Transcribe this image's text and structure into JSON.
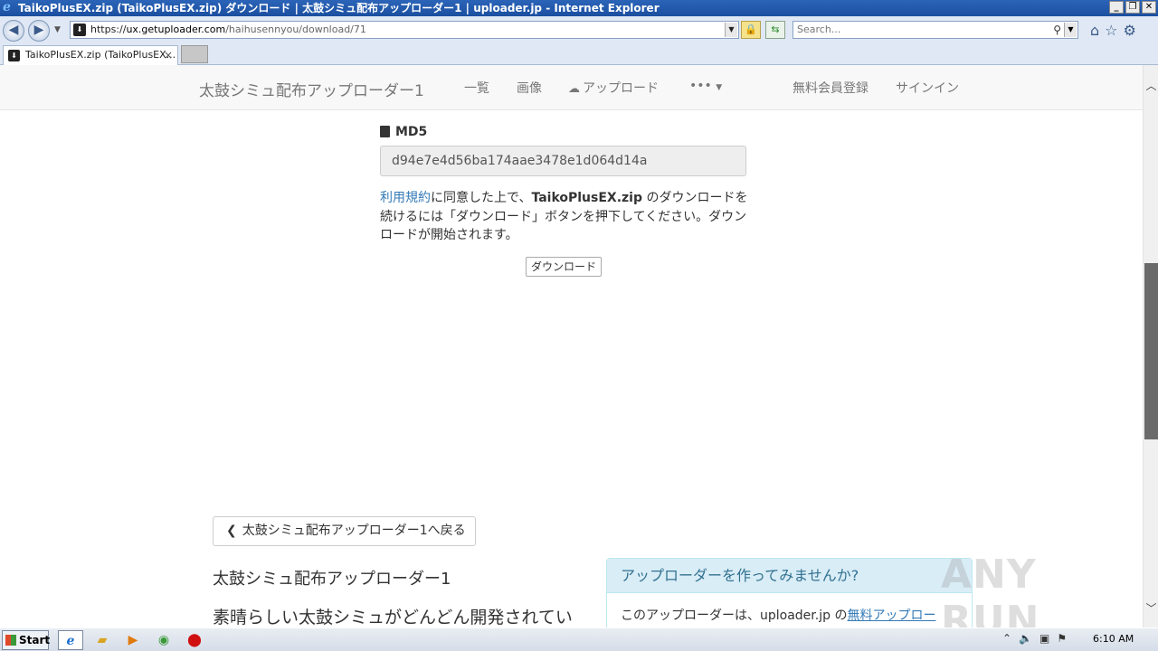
{
  "window": {
    "title": "TaikoPlusEX.zip (TaikoPlusEX.zip) ダウンロード | 太鼓シミュ配布アップローダー1 | uploader.jp - Internet Explorer",
    "controls": {
      "minimize": "_",
      "restore": "❐",
      "close": "✕"
    }
  },
  "addressbar": {
    "scheme": "https://",
    "host": "ux.getuploader.com",
    "path": "/haihusennyou/download/71",
    "search_placeholder": "Search..."
  },
  "tabs": [
    {
      "label": "TaikoPlusEX.zip (TaikoPlusEX...",
      "close": "×"
    }
  ],
  "site_nav": {
    "brand": "太鼓シミュ配布アップローダー1",
    "list": "一覧",
    "images": "画像",
    "upload": "アップロード",
    "more": "•••",
    "register": "無料会員登録",
    "signin": "サインイン"
  },
  "download": {
    "md5_label": "MD5",
    "md5_value": "d94e7e4d56ba174aae3478e1d064d14a",
    "terms_link": "利用規約",
    "terms_text_1": "に同意した上で、",
    "filename": "TaikoPlusEX.zip",
    "terms_text_2": " のダウンロードを続けるには「ダウンロード」ボタンを押下してください。ダウンロードが開始されます。",
    "download_button": "ダウンロード"
  },
  "footer_section": {
    "back_button": "太鼓シミュ配布アップローダー1へ戻る",
    "about_title": "太鼓シミュ配布アップローダー1",
    "about_desc": "素晴らしい太鼓シミュがどんどん開発されてい",
    "panel_title": "アップローダーを作ってみませんか?",
    "panel_text": "このアップローダーは、uploader.jp の",
    "panel_link": "無料アップロー"
  },
  "watermark": "ANY RUN",
  "taskbar": {
    "start": "Start",
    "clock": "6:10 AM"
  }
}
